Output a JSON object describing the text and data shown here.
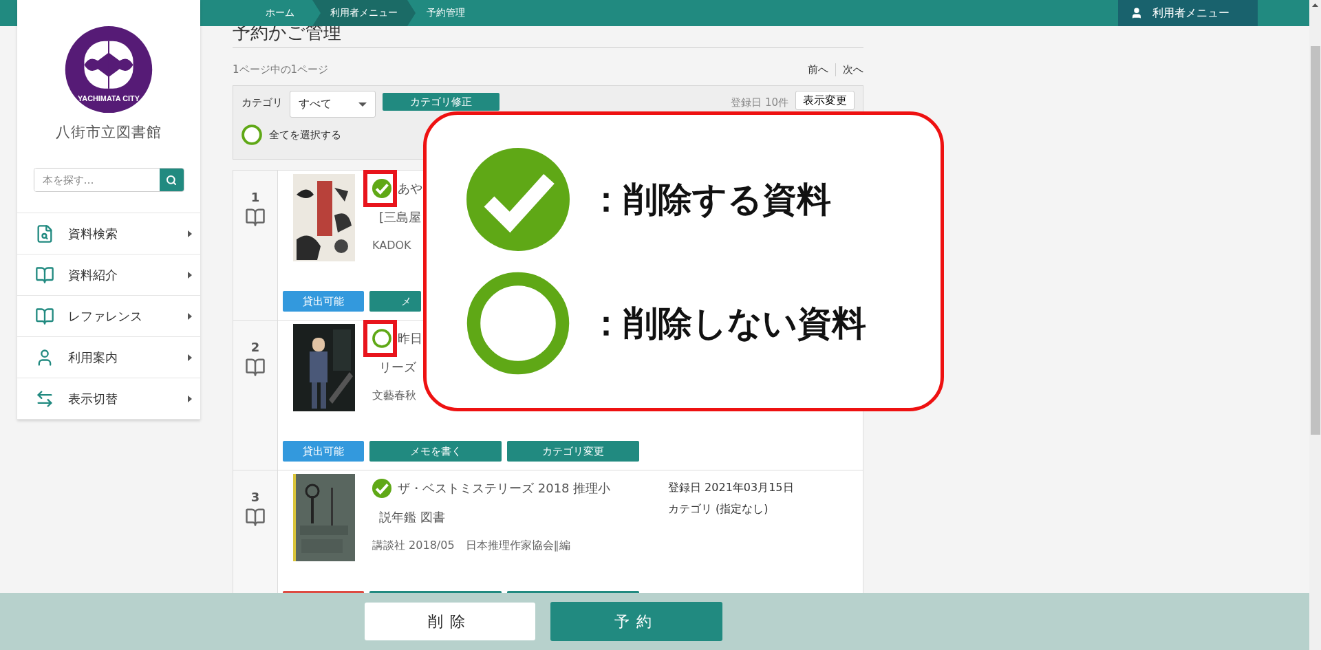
{
  "header": {
    "breadcrumbs": [
      {
        "label": "ホーム",
        "highlighted": false
      },
      {
        "label": "利用者メニュー",
        "highlighted": true
      },
      {
        "label": "予約管理",
        "highlighted": false
      }
    ],
    "user_menu": "利用者メニュー"
  },
  "sidebar": {
    "logo_text": "YACHIMATA CITY",
    "library_name": "八街市立図書館",
    "search": {
      "placeholder": "本を探す…"
    },
    "items": [
      {
        "label": "資料検索",
        "kind": "search"
      },
      {
        "label": "資料紹介",
        "kind": "book"
      },
      {
        "label": "レファレンス",
        "kind": "book"
      },
      {
        "label": "利用案内",
        "kind": "person"
      },
      {
        "label": "表示切替",
        "kind": "switch"
      }
    ]
  },
  "page": {
    "title": "予約かご管理",
    "page_info": "1ページ中の1ページ",
    "prev": "前へ",
    "next": "次へ"
  },
  "filter": {
    "category_label": "カテゴリ",
    "category_value": "すべて",
    "fix_button": "カテゴリ修正",
    "count": "登録日 10件",
    "display_button": "表示変更",
    "select_all": {
      "label": "全てを選択する",
      "checked": false
    }
  },
  "items": [
    {
      "number": "1",
      "checked": true,
      "highlighted": true,
      "title_lines": [
        "あや",
        "[三島屋"
      ],
      "meta": "KADOK",
      "status": {
        "label": "貸出可能",
        "color": "#3399dd"
      },
      "buttons": [
        {
          "kind": "action",
          "label": "メ"
        }
      ]
    },
    {
      "number": "2",
      "checked": false,
      "highlighted": true,
      "title_lines": [
        "昨日",
        "リーズ"
      ],
      "meta": "文藝春秋",
      "status": {
        "label": "貸出可能",
        "color": "#3399dd"
      },
      "buttons": [
        {
          "kind": "action",
          "label": "メモを書く"
        },
        {
          "kind": "action",
          "label": "カテゴリ変更"
        }
      ]
    },
    {
      "number": "3",
      "checked": true,
      "highlighted": false,
      "title_lines": [
        "ザ・ベストミステリーズ 2018 推理小",
        "説年鑑 図書"
      ],
      "meta": "講談社 2018/05　日本推理作家協会∥編",
      "registered": "登録日 2021年03月15日",
      "category": "カテゴリ  (指定なし)",
      "status": {
        "color": "#dd4b42"
      },
      "buttons": [
        {
          "kind": "action"
        },
        {
          "kind": "action"
        }
      ]
    }
  ],
  "legend": {
    "items": [
      {
        "kind": "checked",
        "label": "：削除する資料"
      },
      {
        "kind": "unchecked",
        "label": "：削除しない資料"
      }
    ]
  },
  "footer": {
    "delete_button": "削除",
    "reserve_button": "予約"
  }
}
